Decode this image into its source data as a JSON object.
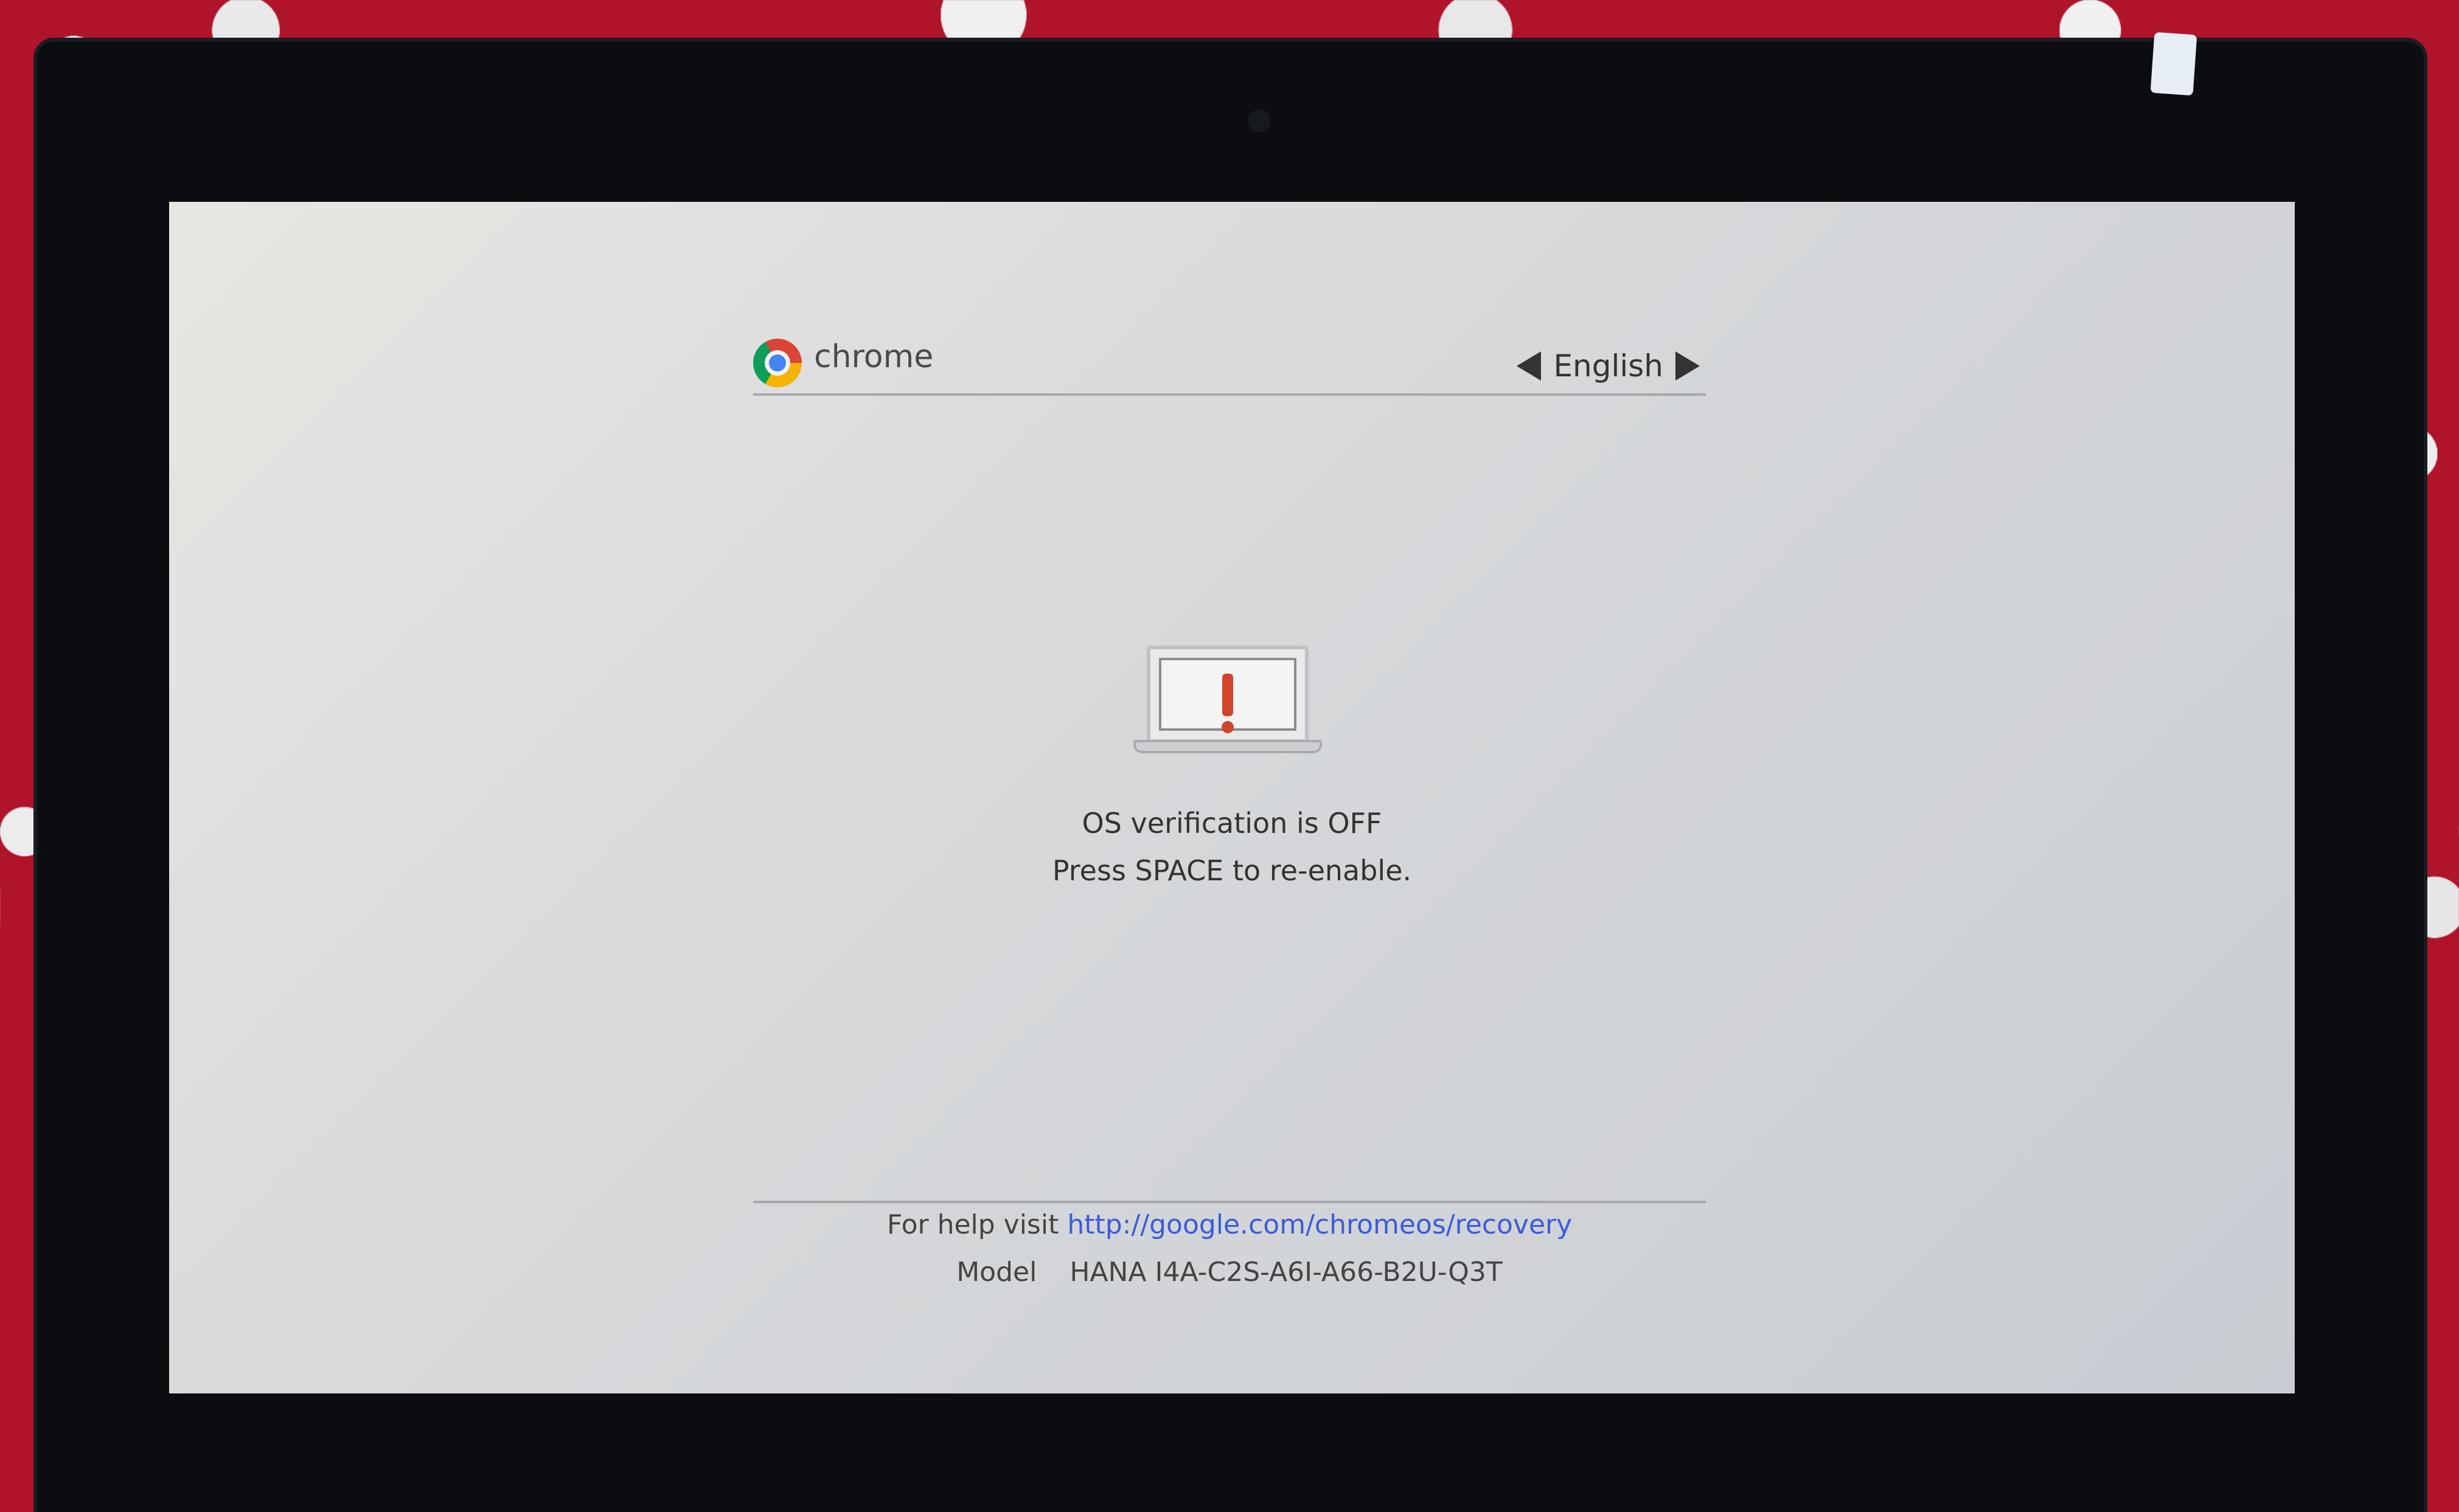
{
  "header": {
    "brand": "chrome",
    "language": "English"
  },
  "main": {
    "line1": "OS verification is OFF",
    "line2": "Press SPACE to re-enable."
  },
  "footer": {
    "help_prefix": "For help visit",
    "help_url": "http://google.com/chromeos/recovery",
    "model_label": "Model",
    "model_value": "HANA I4A-C2S-A6I-A66-B2U-Q3T"
  },
  "colors": {
    "link": "#3b5bdb",
    "warning": "#d0452c"
  },
  "icons": [
    "chrome-logo-icon",
    "arrow-left-icon",
    "arrow-right-icon",
    "laptop-warning-icon"
  ]
}
